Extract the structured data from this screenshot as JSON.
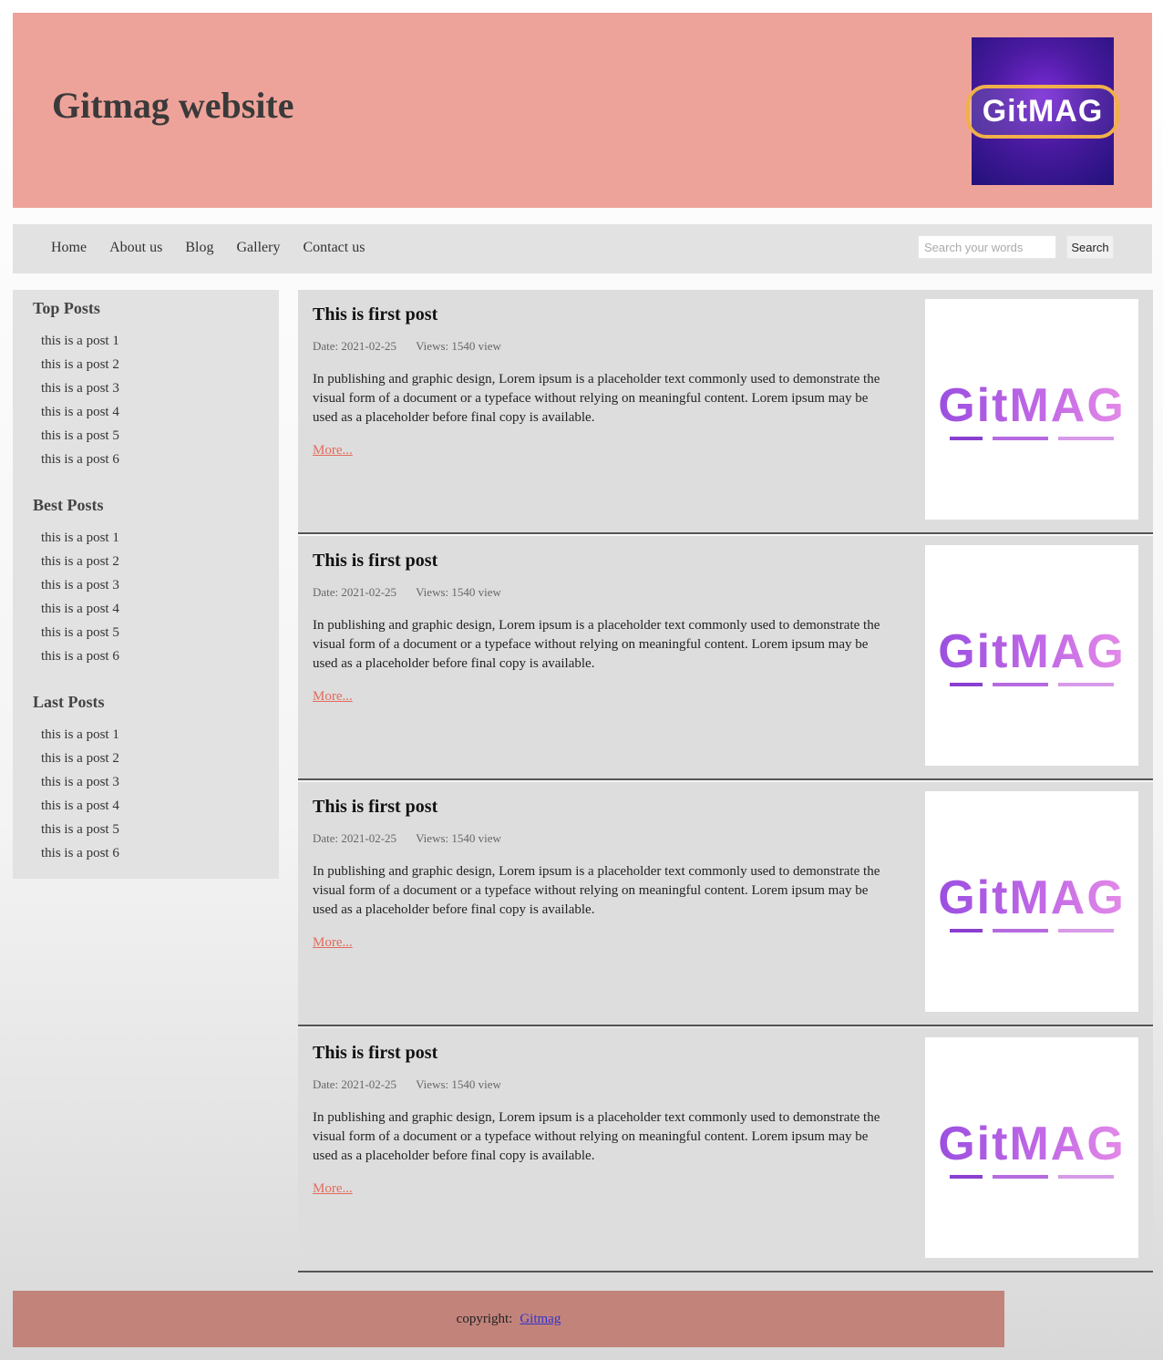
{
  "header": {
    "title": "Gitmag website",
    "logo_text": "GitMAG"
  },
  "nav": {
    "items": [
      "Home",
      "About us",
      "Blog",
      "Gallery",
      "Contact us"
    ],
    "search_placeholder": "Search your words",
    "search_label": "Search"
  },
  "sidebar": {
    "sections": [
      {
        "heading": "Top Posts",
        "items": [
          "this is a post 1",
          "this is a post 2",
          "this is a post 3",
          "this is a post 4",
          "this is a post 5",
          "this is a post 6"
        ]
      },
      {
        "heading": "Best Posts",
        "items": [
          "this is a post 1",
          "this is a post 2",
          "this is a post 3",
          "this is a post 4",
          "this is a post 5",
          "this is a post 6"
        ]
      },
      {
        "heading": "Last Posts",
        "items": [
          "this is a post 1",
          "this is a post 2",
          "this is a post 3",
          "this is a post 4",
          "this is a post 5",
          "this is a post 6"
        ]
      }
    ]
  },
  "posts": [
    {
      "title": "This is first post",
      "date": "Date: 2021-02-25",
      "views": "Views: 1540 view",
      "body": "In publishing and graphic design, Lorem ipsum is a placeholder text commonly used to demonstrate the visual form of a document or a typeface without relying on meaningful content. Lorem ipsum may be used as a placeholder before final copy is available.",
      "more": "More...",
      "image_text": "GitMAG"
    },
    {
      "title": "This is first post",
      "date": "Date: 2021-02-25",
      "views": "Views: 1540 view",
      "body": "In publishing and graphic design, Lorem ipsum is a placeholder text commonly used to demonstrate the visual form of a document or a typeface without relying on meaningful content. Lorem ipsum may be used as a placeholder before final copy is available.",
      "more": "More...",
      "image_text": "GitMAG"
    },
    {
      "title": "This is first post",
      "date": "Date: 2021-02-25",
      "views": "Views: 1540 view",
      "body": "In publishing and graphic design, Lorem ipsum is a placeholder text commonly used to demonstrate the visual form of a document or a typeface without relying on meaningful content. Lorem ipsum may be used as a placeholder before final copy is available.",
      "more": "More...",
      "image_text": "GitMAG"
    },
    {
      "title": "This is first post",
      "date": "Date: 2021-02-25",
      "views": "Views: 1540 view",
      "body": "In publishing and graphic design, Lorem ipsum is a placeholder text commonly used to demonstrate the visual form of a document or a typeface without relying on meaningful content. Lorem ipsum may be used as a placeholder before final copy is available.",
      "more": "More...",
      "image_text": "GitMAG"
    }
  ],
  "footer": {
    "text": "copyright:",
    "link": "Gitmag"
  },
  "colors": {
    "header_bg": "#eea39a",
    "footer_bg": "#c2837a",
    "panel_bg": "#e2e2e2",
    "more_link": "#e36a5a"
  }
}
